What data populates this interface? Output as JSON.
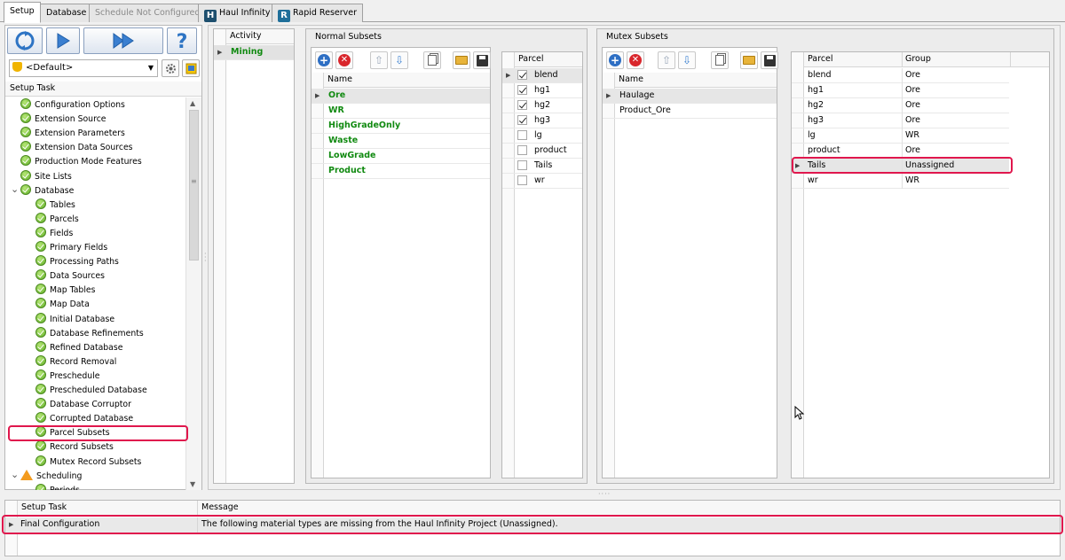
{
  "tabs": [
    {
      "label": "Setup"
    },
    {
      "label": "Database"
    },
    {
      "label": "Schedule Not Configured"
    },
    {
      "label": "Haul Infinity"
    },
    {
      "label": "Rapid Reserver"
    }
  ],
  "left": {
    "profile": "<Default>",
    "header": "Setup Task",
    "items": [
      {
        "label": "Configuration Options",
        "status": "ok",
        "level": 1
      },
      {
        "label": "Extension Source",
        "status": "ok",
        "level": 1
      },
      {
        "label": "Extension Parameters",
        "status": "ok",
        "level": 1
      },
      {
        "label": "Extension Data Sources",
        "status": "ok",
        "level": 1
      },
      {
        "label": "Production Mode Features",
        "status": "ok",
        "level": 1
      },
      {
        "label": "Site Lists",
        "status": "ok",
        "level": 1
      },
      {
        "label": "Database",
        "status": "ok",
        "level": 1,
        "expanded": true
      },
      {
        "label": "Tables",
        "status": "ok",
        "level": 2
      },
      {
        "label": "Parcels",
        "status": "ok",
        "level": 2
      },
      {
        "label": "Fields",
        "status": "ok",
        "level": 2
      },
      {
        "label": "Primary Fields",
        "status": "ok",
        "level": 2
      },
      {
        "label": "Processing Paths",
        "status": "ok",
        "level": 2
      },
      {
        "label": "Data Sources",
        "status": "ok",
        "level": 2
      },
      {
        "label": "Map Tables",
        "status": "ok",
        "level": 2
      },
      {
        "label": "Map Data",
        "status": "ok",
        "level": 2
      },
      {
        "label": "Initial Database",
        "status": "ok",
        "level": 2
      },
      {
        "label": "Database Refinements",
        "status": "ok",
        "level": 2
      },
      {
        "label": "Refined Database",
        "status": "ok",
        "level": 2
      },
      {
        "label": "Record Removal",
        "status": "ok",
        "level": 2
      },
      {
        "label": "Preschedule",
        "status": "ok",
        "level": 2
      },
      {
        "label": "Prescheduled Database",
        "status": "ok",
        "level": 2
      },
      {
        "label": "Database Corruptor",
        "status": "ok",
        "level": 2
      },
      {
        "label": "Corrupted Database",
        "status": "ok",
        "level": 2
      },
      {
        "label": "Parcel Subsets",
        "status": "ok",
        "level": 2,
        "highlighted": true
      },
      {
        "label": "Record Subsets",
        "status": "ok",
        "level": 2
      },
      {
        "label": "Mutex Record Subsets",
        "status": "ok",
        "level": 2
      },
      {
        "label": "Scheduling",
        "status": "warn",
        "level": 1,
        "expanded": true
      },
      {
        "label": "Periods",
        "status": "ok",
        "level": 2
      }
    ]
  },
  "activity": {
    "header": "Activity",
    "rows": [
      "Mining"
    ]
  },
  "normal": {
    "title": "Normal Subsets",
    "name_header": "Name",
    "rows": [
      "Ore",
      "WR",
      "HighGradeOnly",
      "Waste",
      "LowGrade",
      "Product"
    ],
    "parcel_header": "Parcel",
    "parcels": [
      {
        "name": "blend",
        "checked": true
      },
      {
        "name": "hg1",
        "checked": true
      },
      {
        "name": "hg2",
        "checked": true
      },
      {
        "name": "hg3",
        "checked": true
      },
      {
        "name": "lg",
        "checked": false
      },
      {
        "name": "product",
        "checked": false
      },
      {
        "name": "Tails",
        "checked": false
      },
      {
        "name": "wr",
        "checked": false
      }
    ]
  },
  "mutex": {
    "title": "Mutex Subsets",
    "name_header": "Name",
    "rows": [
      "Haulage",
      "Product_Ore"
    ],
    "parcel_header": "Parcel",
    "group_header": "Group",
    "groups": [
      {
        "parcel": "blend",
        "group": "Ore"
      },
      {
        "parcel": "hg1",
        "group": "Ore"
      },
      {
        "parcel": "hg2",
        "group": "Ore"
      },
      {
        "parcel": "hg3",
        "group": "Ore"
      },
      {
        "parcel": "lg",
        "group": "WR"
      },
      {
        "parcel": "product",
        "group": "Ore"
      },
      {
        "parcel": "Tails",
        "group": "Unassigned"
      },
      {
        "parcel": "wr",
        "group": "WR"
      }
    ]
  },
  "bottom": {
    "task_header": "Setup Task",
    "message_header": "Message",
    "rows": [
      {
        "task": "Final Configuration",
        "message": "The following material types are missing from the Haul Infinity Project (Unassigned)."
      }
    ]
  },
  "colors": {
    "highlight": "#e0174d",
    "ok": "#5fae26",
    "warn": "#f39b1e",
    "subset_text": "#118a11"
  }
}
